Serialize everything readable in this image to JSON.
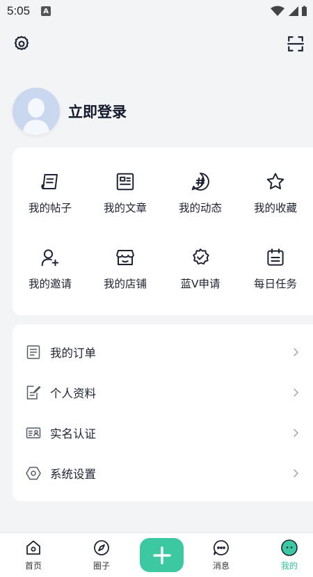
{
  "status_bar": {
    "time": "5:05",
    "notification_letter": "A"
  },
  "profile": {
    "login_label": "立即登录"
  },
  "grid_menu": [
    {
      "label": "我的帖子",
      "icon": "post-icon"
    },
    {
      "label": "我的文章",
      "icon": "article-icon"
    },
    {
      "label": "我的动态",
      "icon": "hashtag-icon"
    },
    {
      "label": "我的收藏",
      "icon": "star-icon"
    },
    {
      "label": "我的邀请",
      "icon": "add-user-icon"
    },
    {
      "label": "我的店铺",
      "icon": "shop-icon"
    },
    {
      "label": "蓝V申请",
      "icon": "verified-badge-icon"
    },
    {
      "label": "每日任务",
      "icon": "calendar-icon"
    }
  ],
  "list_menu": [
    {
      "label": "我的订单",
      "icon": "order-icon"
    },
    {
      "label": "个人资料",
      "icon": "edit-profile-icon"
    },
    {
      "label": "实名认证",
      "icon": "id-card-icon"
    },
    {
      "label": "系统设置",
      "icon": "hexagon-settings-icon"
    }
  ],
  "bottom_nav": {
    "home": "首页",
    "circle": "圈子",
    "messages": "消息",
    "mine": "我的"
  },
  "colors": {
    "accent": "#3cc8a1",
    "active_label": "#2ec29a"
  }
}
